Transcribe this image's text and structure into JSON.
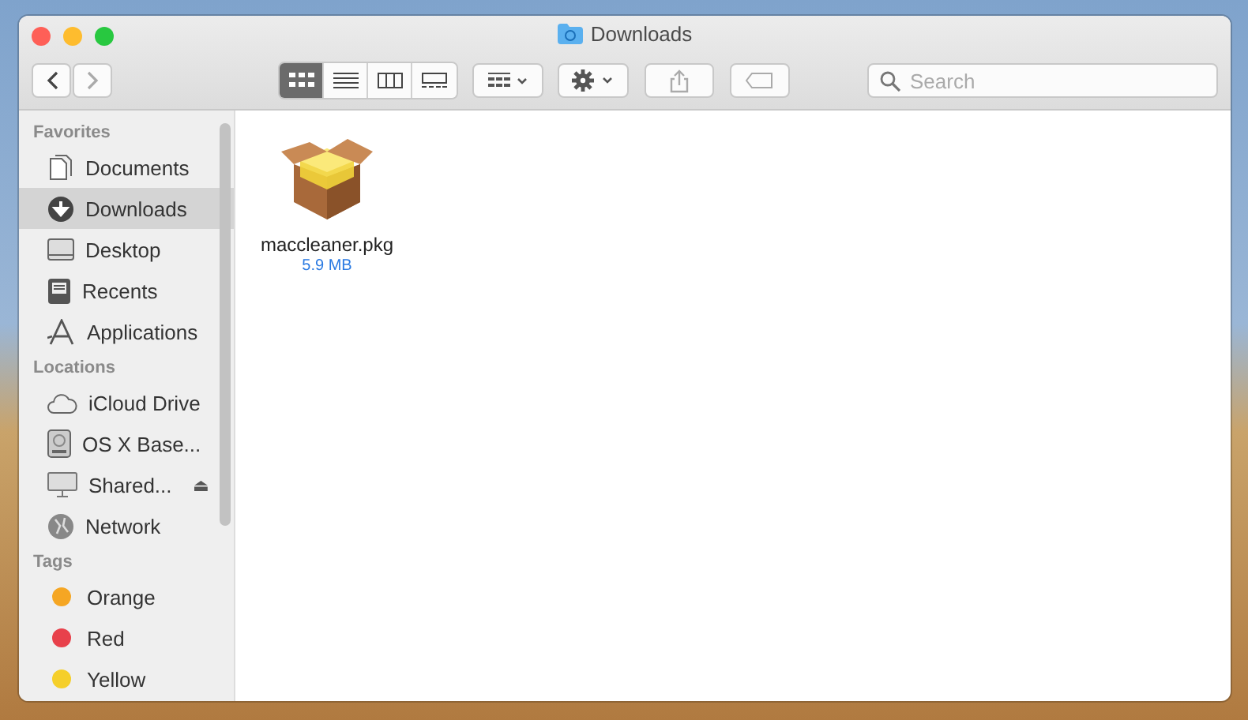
{
  "window": {
    "title": "Downloads"
  },
  "toolbar": {
    "view_modes": [
      {
        "kind": "icons",
        "selected": true
      },
      {
        "kind": "list",
        "selected": false
      },
      {
        "kind": "columns",
        "selected": false
      },
      {
        "kind": "gallery",
        "selected": false
      }
    ],
    "search": {
      "placeholder": "Search"
    }
  },
  "sidebar": {
    "sections": [
      {
        "title": "Favorites",
        "items": [
          {
            "label": "Documents",
            "kind": "documents",
            "selected": false
          },
          {
            "label": "Downloads",
            "kind": "downloads",
            "selected": true
          },
          {
            "label": "Desktop",
            "kind": "desktop",
            "selected": false
          },
          {
            "label": "Recents",
            "kind": "recents",
            "selected": false
          },
          {
            "label": "Applications",
            "kind": "applications",
            "selected": false
          }
        ]
      },
      {
        "title": "Locations",
        "items": [
          {
            "label": "iCloud Drive",
            "kind": "cloud",
            "selected": false
          },
          {
            "label": "OS X Base...",
            "kind": "disk",
            "selected": false
          },
          {
            "label": "Shared...",
            "kind": "shared",
            "selected": false,
            "eject": "⏏"
          },
          {
            "label": "Network",
            "kind": "network",
            "selected": false
          }
        ]
      },
      {
        "title": "Tags",
        "items": [
          {
            "label": "Orange",
            "kind": "tag",
            "color": "#f5a623",
            "selected": false
          },
          {
            "label": "Red",
            "kind": "tag",
            "color": "#e8414b",
            "selected": false
          },
          {
            "label": "Yellow",
            "kind": "tag",
            "color": "#f5cf2a",
            "selected": false
          }
        ]
      }
    ]
  },
  "files": [
    {
      "name": "maccleaner.pkg",
      "size": "5.9 MB"
    }
  ]
}
